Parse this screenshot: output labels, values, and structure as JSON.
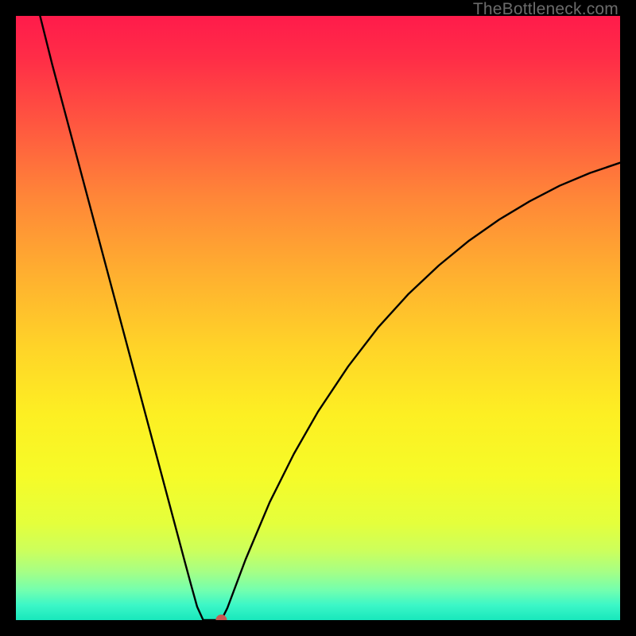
{
  "watermark": "TheBottleneck.com",
  "chart_data": {
    "type": "line",
    "title": "",
    "xlabel": "",
    "ylabel": "",
    "xlim": [
      0,
      100
    ],
    "ylim": [
      0,
      100
    ],
    "curve_x": [
      4,
      6,
      8,
      10,
      12,
      14,
      16,
      18,
      20,
      22,
      24,
      26,
      28,
      29,
      30,
      31,
      32,
      33,
      34,
      35,
      38,
      42,
      46,
      50,
      55,
      60,
      65,
      70,
      75,
      80,
      85,
      90,
      95,
      100
    ],
    "curve_y": [
      100,
      92,
      84.5,
      77,
      69.5,
      62,
      54.5,
      47,
      39.5,
      32,
      24.5,
      17,
      9.5,
      5.8,
      2.2,
      0,
      0,
      0,
      0,
      2,
      10,
      19.5,
      27.5,
      34.5,
      42,
      48.5,
      54,
      58.7,
      62.8,
      66.3,
      69.3,
      71.9,
      74,
      75.7
    ],
    "marker": {
      "x": 34,
      "y": 0
    },
    "gradient_stops": [
      {
        "offset": 0.0,
        "color": "#ff1b4b"
      },
      {
        "offset": 0.07,
        "color": "#ff2d47"
      },
      {
        "offset": 0.18,
        "color": "#ff5740"
      },
      {
        "offset": 0.3,
        "color": "#ff8638"
      },
      {
        "offset": 0.42,
        "color": "#ffad30"
      },
      {
        "offset": 0.55,
        "color": "#ffd428"
      },
      {
        "offset": 0.66,
        "color": "#fdef23"
      },
      {
        "offset": 0.76,
        "color": "#f6fb28"
      },
      {
        "offset": 0.84,
        "color": "#e4ff3c"
      },
      {
        "offset": 0.885,
        "color": "#ccff5c"
      },
      {
        "offset": 0.92,
        "color": "#a6ff85"
      },
      {
        "offset": 0.95,
        "color": "#74ffae"
      },
      {
        "offset": 0.975,
        "color": "#3cf7c7"
      },
      {
        "offset": 1.0,
        "color": "#18e7bc"
      }
    ]
  }
}
